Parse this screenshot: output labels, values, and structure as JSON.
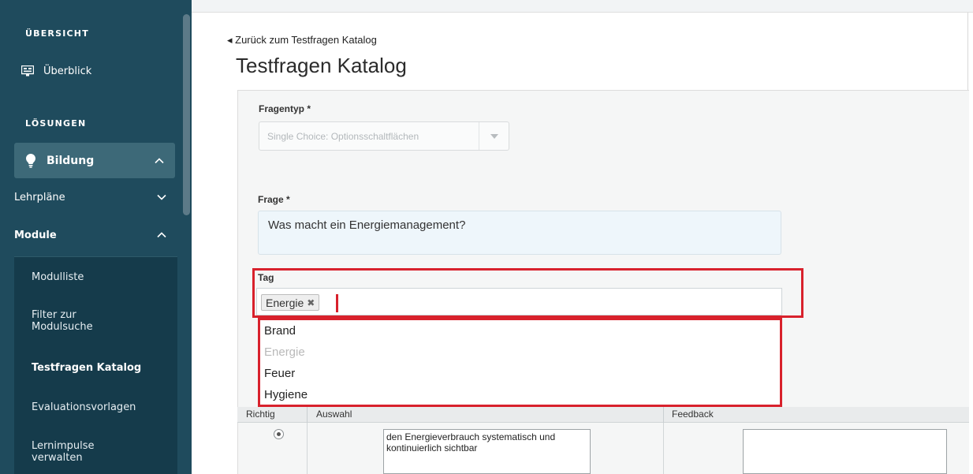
{
  "sidebar": {
    "section_overview": "ÜBERSICHT",
    "item_overview": "Überblick",
    "section_solutions": "LÖSUNGEN",
    "item_bildung": "Bildung",
    "item_lehrplaene": "Lehrpläne",
    "item_module": "Module",
    "submodules": [
      {
        "label": "Modulliste"
      },
      {
        "label": "Filter zur Modulsuche"
      },
      {
        "label": "Testfragen Katalog"
      },
      {
        "label": "Evaluationsvorlagen"
      },
      {
        "label": "Lernimpulse verwalten"
      }
    ],
    "active_submodule": "Testfragen Katalog"
  },
  "header": {
    "back_link": "◂ Zurück zum Testfragen Katalog",
    "title": "Testfragen Katalog"
  },
  "form": {
    "question_type_label": "Fragentyp *",
    "question_type_value": "Single Choice: Optionsschaltflächen",
    "question_label": "Frage *",
    "question_value": "Was macht ein Energiemanagement?",
    "tag_label": "Tag",
    "selected_tags": [
      "Energie"
    ],
    "tag_options": [
      {
        "label": "Brand",
        "disabled": false
      },
      {
        "label": "Energie",
        "disabled": true
      },
      {
        "label": "Feuer",
        "disabled": false
      },
      {
        "label": "Hygiene",
        "disabled": false
      }
    ]
  },
  "answers_table": {
    "columns": [
      "Richtig",
      "Auswahl",
      "Feedback"
    ],
    "rows": [
      {
        "correct": true,
        "answer": "den Energieverbrauch systematisch und kontinuierlich sichtbar",
        "feedback": ""
      }
    ]
  },
  "colors": {
    "sidebar_bg": "#1f4b5d",
    "sidebar_active": "#3d6978",
    "highlight_red": "#d8212c"
  }
}
